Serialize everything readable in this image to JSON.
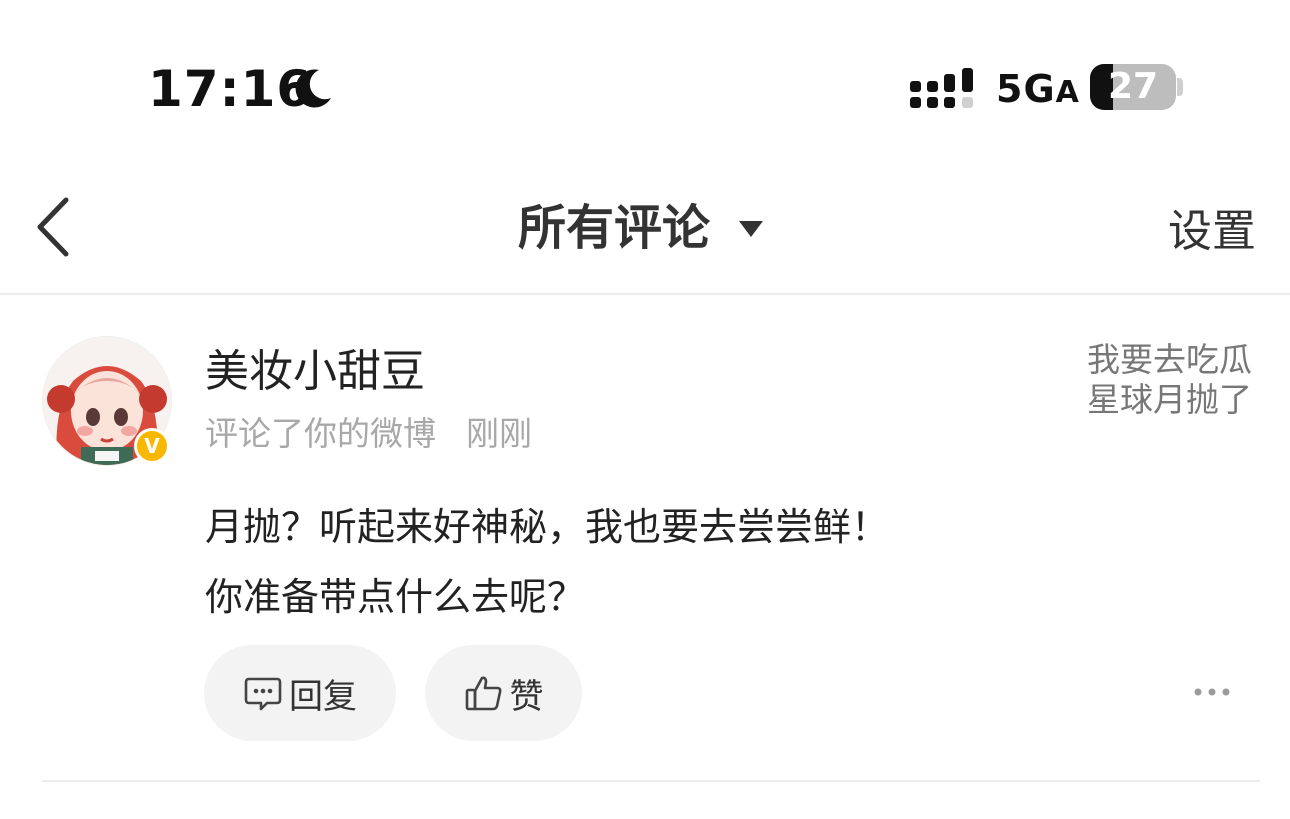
{
  "status_bar": {
    "time": "17:16",
    "network": "5G",
    "network_suffix": "A",
    "battery_percent": "27",
    "battery_level": 0.27,
    "icons": [
      "moon-icon",
      "signal-icon",
      "battery-icon"
    ]
  },
  "nav": {
    "title": "所有评论",
    "settings_label": "设置",
    "icons": [
      "back-arrow-icon",
      "caret-down-icon"
    ]
  },
  "comment": {
    "user_name": "美妆小甜豆",
    "verified_badge": "V",
    "meta_action": "评论了你的微博",
    "meta_time": "刚刚",
    "source_post": "我要去吃瓜星球月抛了",
    "body_line1": "月抛？听起来好神秘，我也要去尝尝鲜！",
    "body_line2": "你准备带点什么去呢？",
    "reply_label": "回复",
    "like_label": "赞",
    "icons": [
      "reply-icon",
      "thumbs-up-icon",
      "more-icon"
    ]
  },
  "colors": {
    "badge": "#f8b800",
    "pill_bg": "#f3f3f3",
    "meta_gray": "#a8a8a8"
  }
}
